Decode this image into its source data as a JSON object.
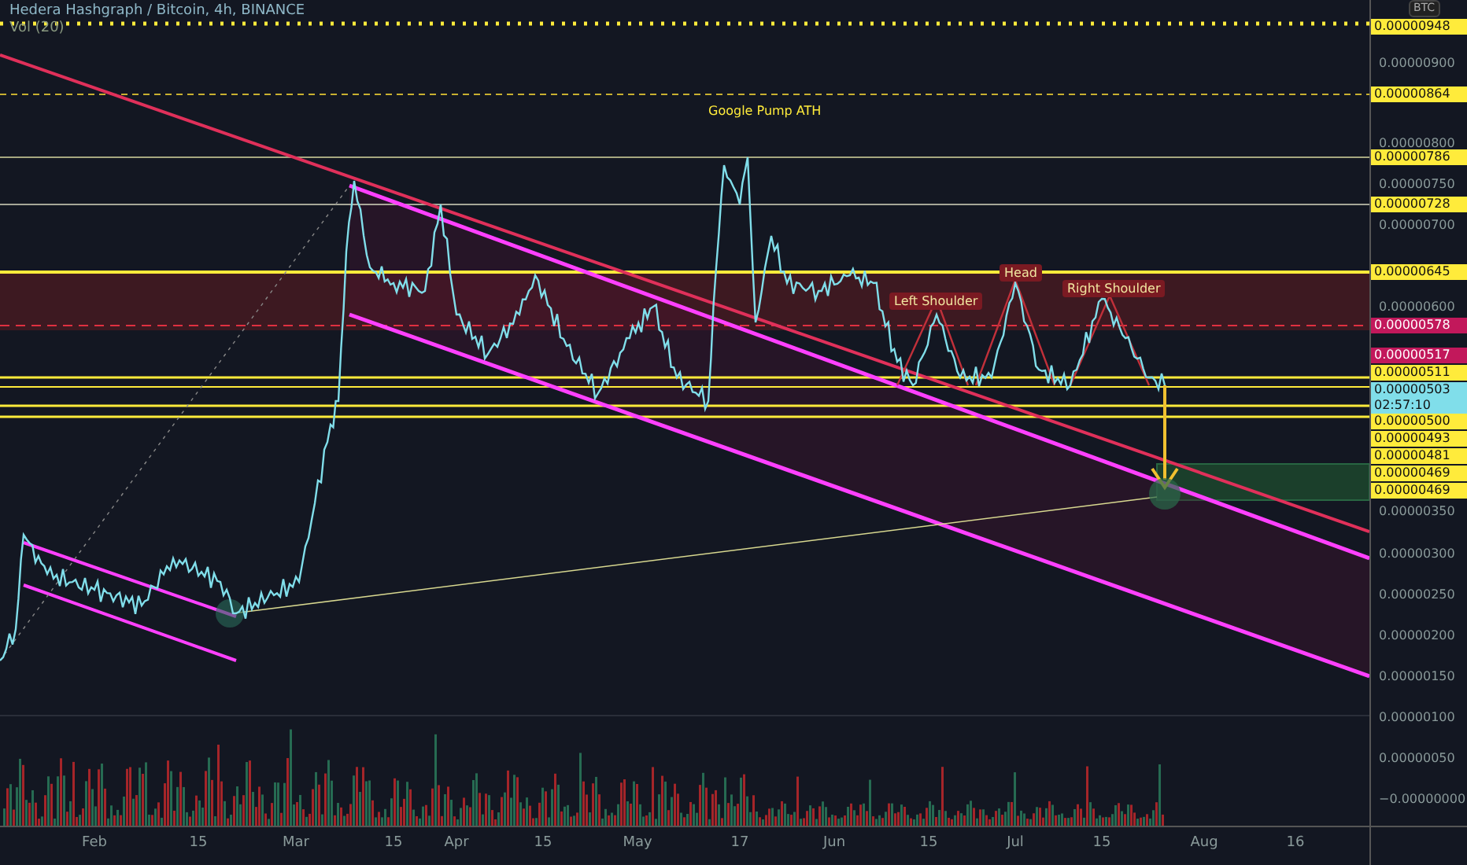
{
  "header": {
    "symbol": "Hedera Hashgraph / Bitcoin, 4h, BINANCE",
    "indicator": "Vol (20)"
  },
  "currency": "BTC",
  "annotations": [
    {
      "kind": "plain",
      "text": "Google Pump ATH"
    },
    {
      "kind": "tag",
      "text": "Left Shoulder"
    },
    {
      "kind": "tag",
      "text": "Head"
    },
    {
      "kind": "tag",
      "text": "Right Shoulder"
    }
  ],
  "price_axis": {
    "ticks": [
      "0.00000900",
      "0.00000800",
      "0.00000750",
      "0.00000700",
      "0.00000600",
      "0.00000350",
      "0.00000300",
      "0.00000250",
      "0.00000200",
      "0.00000150",
      "0.00000100",
      "0.00000050",
      "−0.00000000"
    ],
    "price_tags": [
      {
        "text": "0.00000948",
        "color": "#ffeb3b"
      },
      {
        "text": "0.00000864",
        "color": "#ffeb3b"
      },
      {
        "text": "0.00000786",
        "color": "#ffeb3b"
      },
      {
        "text": "0.00000728",
        "color": "#ffeb3b"
      },
      {
        "text": "0.00000645",
        "color": "#ffeb3b"
      },
      {
        "text": "0.00000578",
        "color": "#c2185b"
      },
      {
        "text": "0.00000517",
        "color": "#c2185b"
      },
      {
        "text": "0.00000511",
        "color": "#ffeb3b"
      },
      {
        "text": "0.00000503",
        "color": "#80deea",
        "countdown": "02:57:10"
      },
      {
        "text": "0.00000500",
        "color": "#ffeb3b"
      },
      {
        "text": "0.00000493",
        "color": "#ffeb3b"
      },
      {
        "text": "0.00000481",
        "color": "#ffeb3b"
      },
      {
        "text": "0.00000469",
        "color": "#ffeb3b"
      },
      {
        "text": "0.00000469",
        "color": "#ffeb3b"
      }
    ]
  },
  "time_axis": [
    "Feb",
    "15",
    "Mar",
    "15",
    "Apr",
    "15",
    "May",
    "17",
    "Jun",
    "15",
    "Jul",
    "15",
    "Aug",
    "16"
  ]
}
